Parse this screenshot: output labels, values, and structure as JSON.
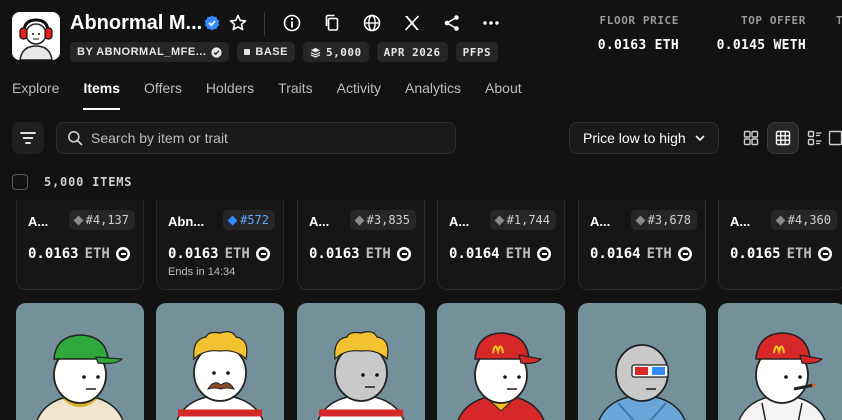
{
  "collection": {
    "name": "Abnormal M...",
    "creator_chip": "BY ABNORMAL_MFE...",
    "chain_chip": "BASE",
    "supply_chip": "5,000",
    "date_chip": "APR 2026",
    "category_chip": "PFPS"
  },
  "stats": [
    {
      "label": "FLOOR PRICE",
      "value": "0.0163 ETH"
    },
    {
      "label": "TOP OFFER",
      "value": "0.0145 WETH"
    },
    {
      "label": "T",
      "value": ""
    }
  ],
  "tabs": [
    "Explore",
    "Items",
    "Offers",
    "Holders",
    "Traits",
    "Activity",
    "Analytics",
    "About"
  ],
  "active_tab": "Items",
  "search": {
    "placeholder": "Search by item or trait"
  },
  "sort": {
    "label": "Price low to high"
  },
  "items_count": "5,000 ITEMS",
  "cards": [
    {
      "name": "A...",
      "rank": "#4,137",
      "price": "0.0163",
      "currency": "ETH",
      "ends": ""
    },
    {
      "name": "Abn...",
      "rank": "#572",
      "price": "0.0163",
      "currency": "ETH",
      "ends": "Ends in 14:34"
    },
    {
      "name": "A...",
      "rank": "#3,835",
      "price": "0.0163",
      "currency": "ETH",
      "ends": ""
    },
    {
      "name": "A...",
      "rank": "#1,744",
      "price": "0.0164",
      "currency": "ETH",
      "ends": ""
    },
    {
      "name": "A...",
      "rank": "#3,678",
      "price": "0.0164",
      "currency": "ETH",
      "ends": ""
    },
    {
      "name": "A...",
      "rank": "#4,360",
      "price": "0.0165",
      "currency": "ETH",
      "ends": ""
    }
  ],
  "colors": {
    "background": "#121212",
    "accent_blue": "#2f8bff",
    "card_image_bg": "#73909b"
  }
}
